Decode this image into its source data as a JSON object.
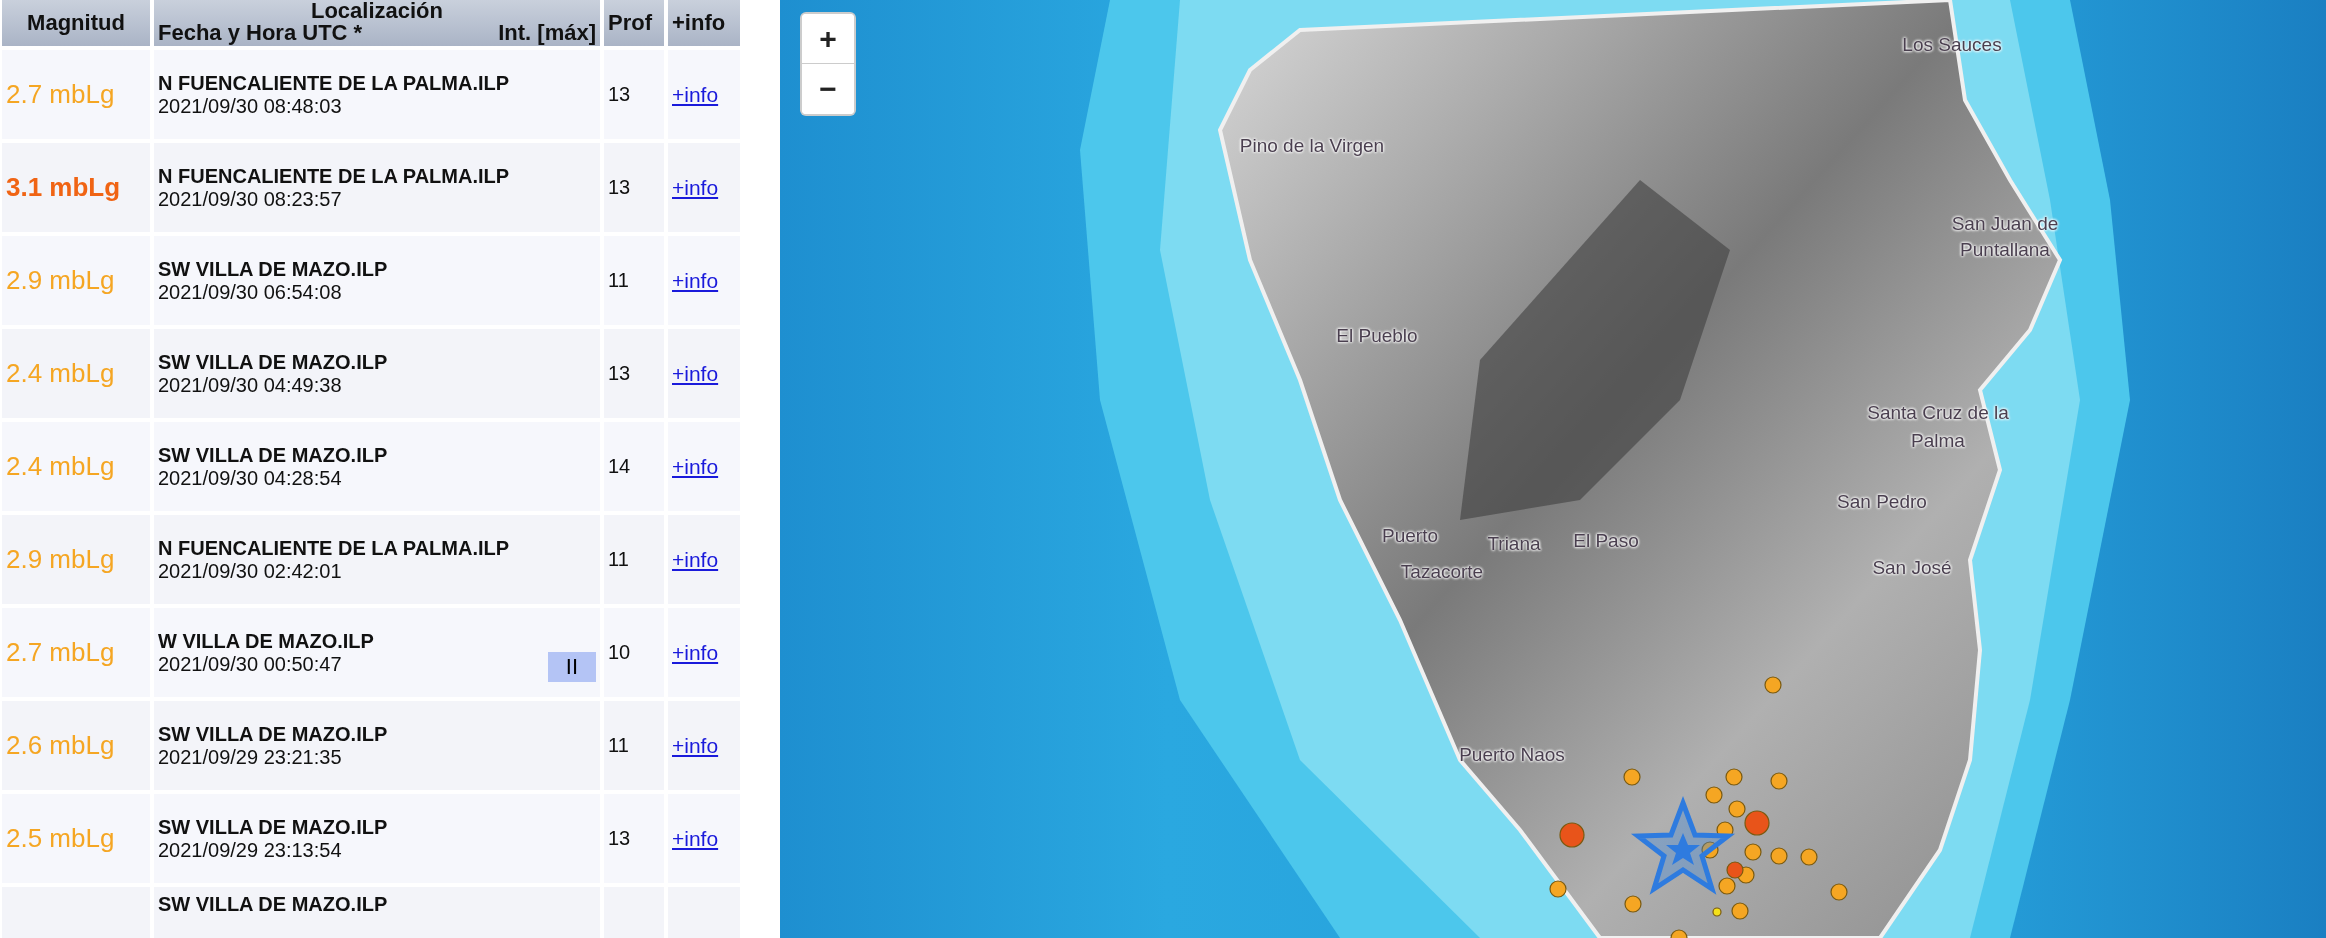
{
  "table": {
    "columns": {
      "magnitude": "Magnitud",
      "location": "Localización",
      "datetime": "Fecha y Hora UTC *",
      "intensity": "Int. [máx]",
      "depth": "Prof",
      "info": "+info"
    },
    "rows": [
      {
        "magnitude": "2.7 mbLg",
        "color": "#f5a623",
        "strong": false,
        "location": "N FUENCALIENTE DE LA PALMA.ILP",
        "datetime": "2021/09/30 08:48:03",
        "depth": "13",
        "info": "+info"
      },
      {
        "magnitude": "3.1 mbLg",
        "color": "#f06414",
        "strong": true,
        "location": "N FUENCALIENTE DE LA PALMA.ILP",
        "datetime": "2021/09/30 08:23:57",
        "depth": "13",
        "info": "+info"
      },
      {
        "magnitude": "2.9 mbLg",
        "color": "#f5a623",
        "strong": false,
        "location": "SW VILLA DE MAZO.ILP",
        "datetime": "2021/09/30 06:54:08",
        "depth": "11",
        "info": "+info"
      },
      {
        "magnitude": "2.4 mbLg",
        "color": "#f5a623",
        "strong": false,
        "location": "SW VILLA DE MAZO.ILP",
        "datetime": "2021/09/30 04:49:38",
        "depth": "13",
        "info": "+info"
      },
      {
        "magnitude": "2.4 mbLg",
        "color": "#f5a623",
        "strong": false,
        "location": "SW VILLA DE MAZO.ILP",
        "datetime": "2021/09/30 04:28:54",
        "depth": "14",
        "info": "+info"
      },
      {
        "magnitude": "2.9 mbLg",
        "color": "#f5a623",
        "strong": false,
        "location": "N FUENCALIENTE DE LA PALMA.ILP",
        "datetime": "2021/09/30 02:42:01",
        "depth": "11",
        "info": "+info"
      },
      {
        "magnitude": "2.7 mbLg",
        "color": "#f5a623",
        "strong": false,
        "location": "W VILLA DE MAZO.ILP",
        "datetime": "2021/09/30 00:50:47",
        "intensity": "II",
        "depth": "10",
        "info": "+info"
      },
      {
        "magnitude": "2.6 mbLg",
        "color": "#f5a623",
        "strong": false,
        "location": "SW VILLA DE MAZO.ILP",
        "datetime": "2021/09/29 23:21:35",
        "depth": "11",
        "info": "+info"
      },
      {
        "magnitude": "2.5 mbLg",
        "color": "#f5a623",
        "strong": false,
        "location": "SW VILLA DE MAZO.ILP",
        "datetime": "2021/09/29 23:13:54",
        "depth": "13",
        "info": "+info"
      },
      {
        "location": "SW VILLA DE MAZO.ILP"
      }
    ]
  },
  "map": {
    "zoom_in": "+",
    "zoom_out": "−",
    "labels": [
      "Los Sauces",
      "Pino de la Virgen",
      "San Juan de",
      "Puntallana",
      "El Pueblo",
      "Santa Cruz de la",
      "Palma",
      "San Pedro",
      "Puerto",
      "Triana",
      "El Paso",
      "Tazacorte",
      "San José",
      "Puerto Naos"
    ]
  }
}
